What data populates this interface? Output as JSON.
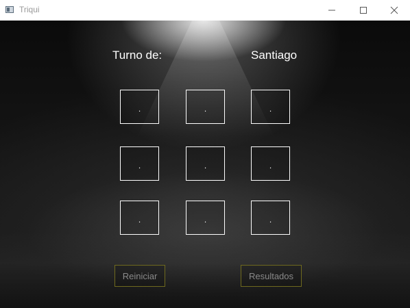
{
  "window": {
    "title": "Triqui",
    "controls": [
      "minimize-icon",
      "maximize-icon",
      "close-icon"
    ]
  },
  "game": {
    "turn_label": "Turno de:",
    "current_player": "Santiago",
    "board": [
      [
        ".",
        ".",
        "."
      ],
      [
        ".",
        ".",
        "."
      ],
      [
        ".",
        ".",
        "."
      ]
    ]
  },
  "actions": {
    "reset_label": "Reiniciar",
    "results_label": "Resultados"
  },
  "colors": {
    "cell_border": "#ffffff",
    "button_border": "#6f6a1e",
    "button_text": "#8a8a8a",
    "text": "#ffffff"
  }
}
